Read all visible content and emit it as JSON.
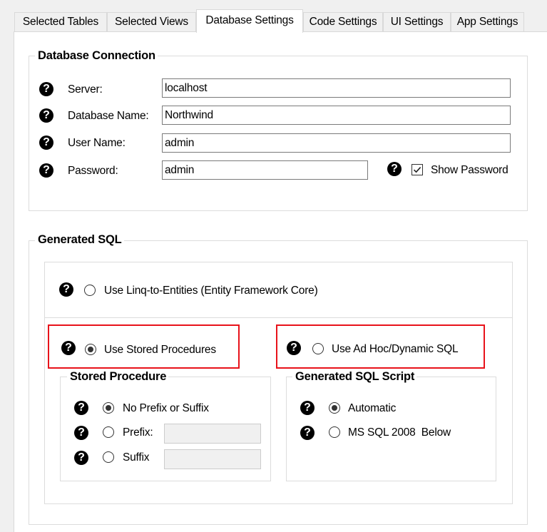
{
  "tabs": [
    {
      "label": "Selected Tables"
    },
    {
      "label": "Selected Views"
    },
    {
      "label": "Database Settings",
      "active": true
    },
    {
      "label": "Code Settings"
    },
    {
      "label": "UI Settings"
    },
    {
      "label": "App Settings"
    }
  ],
  "database_connection": {
    "legend": "Database Connection",
    "server_label": "Server:",
    "server_value": "localhost",
    "database_label": "Database Name:",
    "database_value": "Northwind",
    "user_label": "User Name:",
    "user_value": "admin",
    "password_label": "Password:",
    "password_value": "admin",
    "show_password_label": "Show Password",
    "show_password_checked": true
  },
  "generated_sql": {
    "legend": "Generated SQL",
    "linq_label": "Use Linq-to-Entities (Entity Framework Core)",
    "stored_proc_label": "Use Stored Procedures",
    "adhoc_label": "Use Ad Hoc/Dynamic SQL",
    "selected": "stored_procedures"
  },
  "stored_procedure": {
    "legend": "Stored Procedure",
    "no_prefix_label": "No Prefix or Suffix",
    "prefix_label": "Prefix:",
    "prefix_value": "",
    "suffix_label": "Suffix",
    "suffix_value": "",
    "selected": "no_prefix"
  },
  "generated_sql_script": {
    "legend": "Generated SQL Script",
    "automatic_label": "Automatic",
    "mssql2008_label": "MS SQL 2008  Below",
    "selected": "automatic"
  },
  "help_icon_glyph": "?",
  "colors": {
    "highlight": "#e8121a",
    "window": "#f0f0f0",
    "panel": "#ffffff"
  }
}
